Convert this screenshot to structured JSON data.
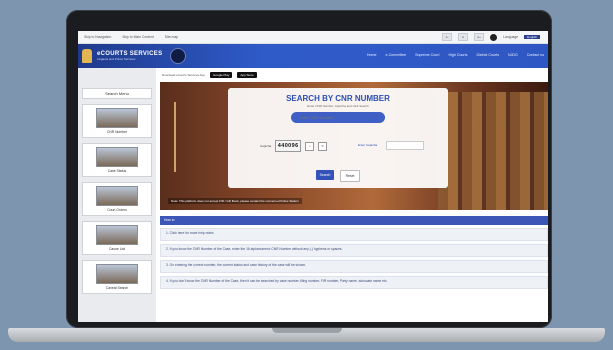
{
  "topbar": {
    "links": [
      "Skip to Navigation",
      "Skip to Main Content",
      "Site map"
    ],
    "size_buttons": [
      "A-",
      "A",
      "A+"
    ],
    "language_label": "Language",
    "language_value": "English"
  },
  "header": {
    "brand_title": "eCOURTS SERVICES",
    "brand_subtitle": "Litigants and Police Services",
    "nav": [
      "Home",
      "e-Committee",
      "Supreme Court",
      "High Courts",
      "District Courts",
      "NJDG",
      "Contact us"
    ]
  },
  "sidebar": {
    "title": "Search Menu",
    "items": [
      "CNR Number",
      "Case Status",
      "Court Orders",
      "Cause List",
      "Caveat Search"
    ]
  },
  "appbar": {
    "text": "Download eCourts Services App",
    "google_play": "Google Play",
    "app_store": "App Store"
  },
  "search": {
    "heading": "SEARCH BY CNR NUMBER",
    "subtext": "Enter CNR Number, Captcha and click Search",
    "cnr_placeholder": "Enter CNR Number",
    "captcha_label": "Captcha",
    "captcha_code": "440096",
    "captcha_input_label": "Enter Captcha",
    "search_label": "Search",
    "reset_label": "Reset"
  },
  "hero_caption": "Note: This platform does not accept FIR / GD Book, please contact the concerned Police Station",
  "info": {
    "bar_title": "How to",
    "notes": [
      "1. Click here for more help notes",
      "2. If you know the CNR Number of the Case, enter the 16 alphanumeric CNR Number without any (-) hyphens or spaces.",
      "3. On entering the correct number, the current status and case history of the case will be shown.",
      "4. If you don't know the CNR Number of the Case, then it can be searched by case number, filing number, FIR number, Party name, advocate name etc."
    ]
  }
}
